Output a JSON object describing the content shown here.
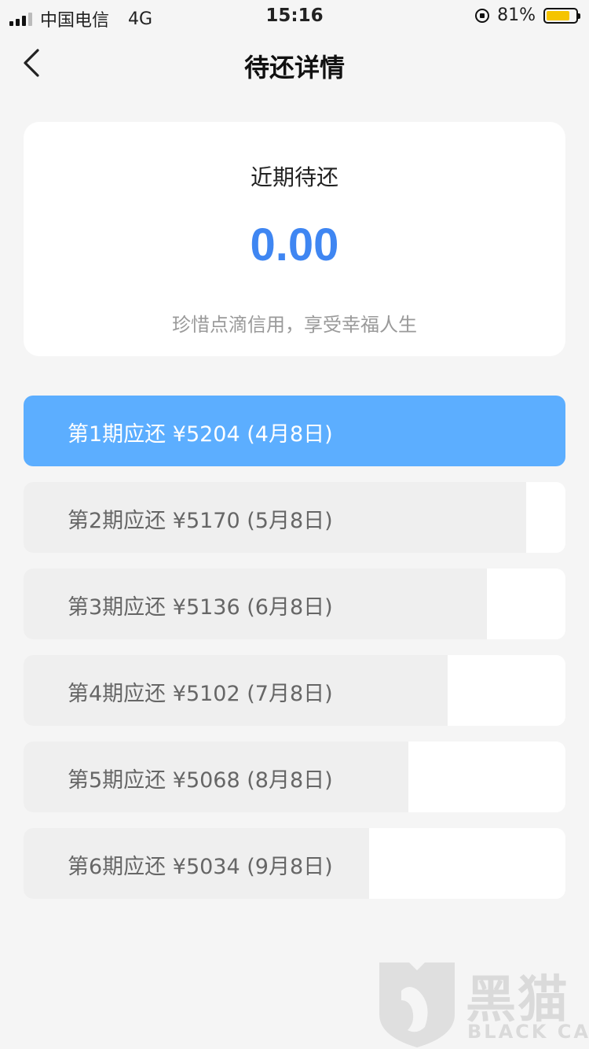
{
  "status_bar": {
    "carrier": "中国电信",
    "network": "4G",
    "time": "15:16",
    "battery_percent": "81%",
    "battery_level": 0.81,
    "battery_color": "#f5c400"
  },
  "nav": {
    "back_icon": "chevron-left-icon",
    "title": "待还详情"
  },
  "summary": {
    "title": "近期待还",
    "amount": "0.00",
    "note": "珍惜点滴信用，享受幸福人生",
    "amount_color": "#3f86f2"
  },
  "installments": [
    {
      "label": "第1期应还 ¥5204 (4月8日)",
      "active": true,
      "fill": 1.0
    },
    {
      "label": "第2期应还 ¥5170 (5月8日)",
      "active": false,
      "fill": 0.927
    },
    {
      "label": "第3期应还 ¥5136 (6月8日)",
      "active": false,
      "fill": 0.855
    },
    {
      "label": "第4期应还 ¥5102 (7月8日)",
      "active": false,
      "fill": 0.783
    },
    {
      "label": "第5期应还 ¥5068 (8月8日)",
      "active": false,
      "fill": 0.71
    },
    {
      "label": "第6期应还 ¥5034 (9月8日)",
      "active": false,
      "fill": 0.638
    }
  ],
  "colors": {
    "active_bar": "#5caeff",
    "inactive_bar": "#efefef",
    "background": "#f5f5f5"
  },
  "watermark": {
    "text_cn": "黑猫",
    "text_en": "BLACK CAT",
    "icon": "black-cat-shield-icon"
  }
}
